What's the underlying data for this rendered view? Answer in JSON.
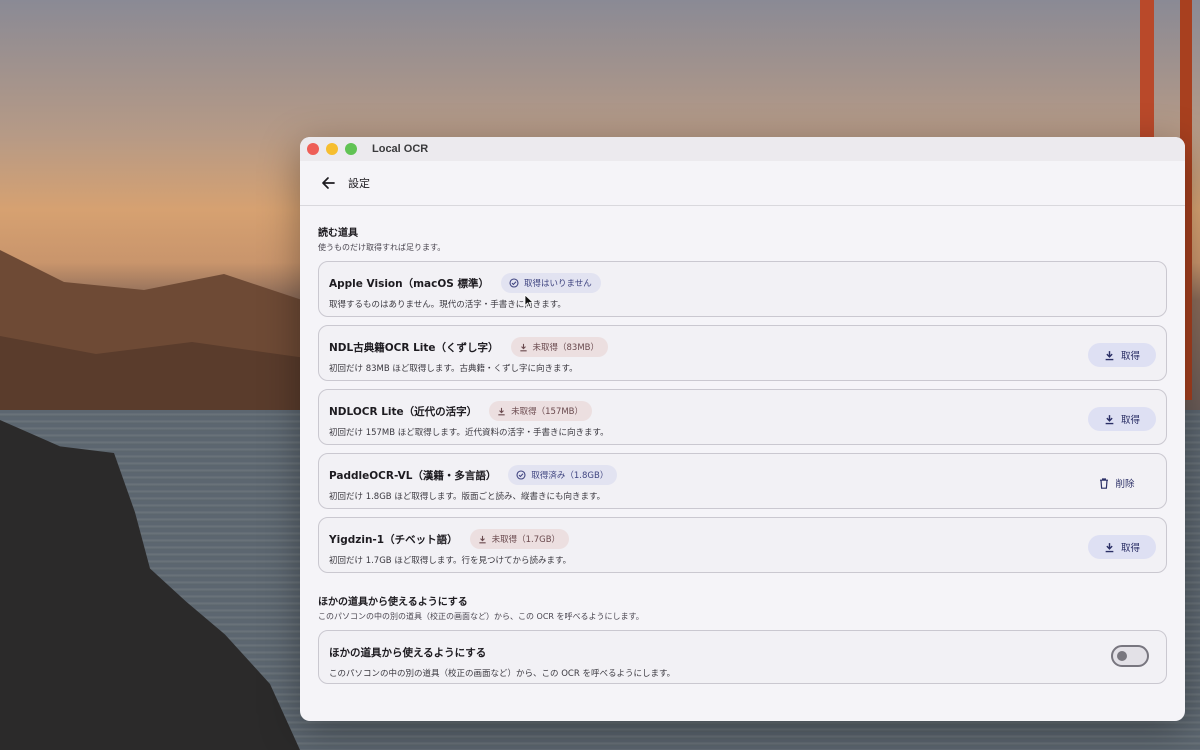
{
  "window": {
    "title": "Local OCR"
  },
  "appbar": {
    "title": "設定"
  },
  "readers": {
    "title": "読む道具",
    "subtitle": "使うものだけ取得すれば足ります。",
    "items": [
      {
        "name": "Apple Vision（macOS 標準）",
        "status": "取得はいりません",
        "status_kind": "ok",
        "desc": "取得するものはありません。現代の活字・手書きに向きます。",
        "action": ""
      },
      {
        "name": "NDL古典籍OCR Lite（くずし字）",
        "status": "未取得（83MB）",
        "status_kind": "missing",
        "desc": "初回だけ 83MB ほど取得します。古典籍・くずし字に向きます。",
        "action": "取得"
      },
      {
        "name": "NDLOCR Lite（近代の活字）",
        "status": "未取得（157MB）",
        "status_kind": "missing",
        "desc": "初回だけ 157MB ほど取得します。近代資料の活字・手書きに向きます。",
        "action": "取得"
      },
      {
        "name": "PaddleOCR-VL（漢籍・多言語）",
        "status": "取得済み（1.8GB）",
        "status_kind": "ok",
        "desc": "初回だけ 1.8GB ほど取得します。版面ごと読み、縦書きにも向きます。",
        "action": "削除"
      },
      {
        "name": "Yigdzin-1（チベット語）",
        "status": "未取得（1.7GB）",
        "status_kind": "missing",
        "desc": "初回だけ 1.7GB ほど取得します。行を見つけてから読みます。",
        "action": "取得"
      }
    ]
  },
  "integration": {
    "title": "ほかの道具から使えるようにする",
    "subtitle": "このパソコンの中の別の道具（校正の画面など）から、この OCR を呼べるようにします。",
    "toggle_title": "ほかの道具から使えるようにする",
    "toggle_desc": "このパソコンの中の別の道具（校正の画面など）から、この OCR を呼べるようにします。",
    "enabled": false
  },
  "colors": {
    "accent": "#3f4480",
    "chip_ok_bg": "#e2e3f1",
    "chip_missing_bg": "#ecdfe0",
    "button_bg": "#dee0f3"
  }
}
